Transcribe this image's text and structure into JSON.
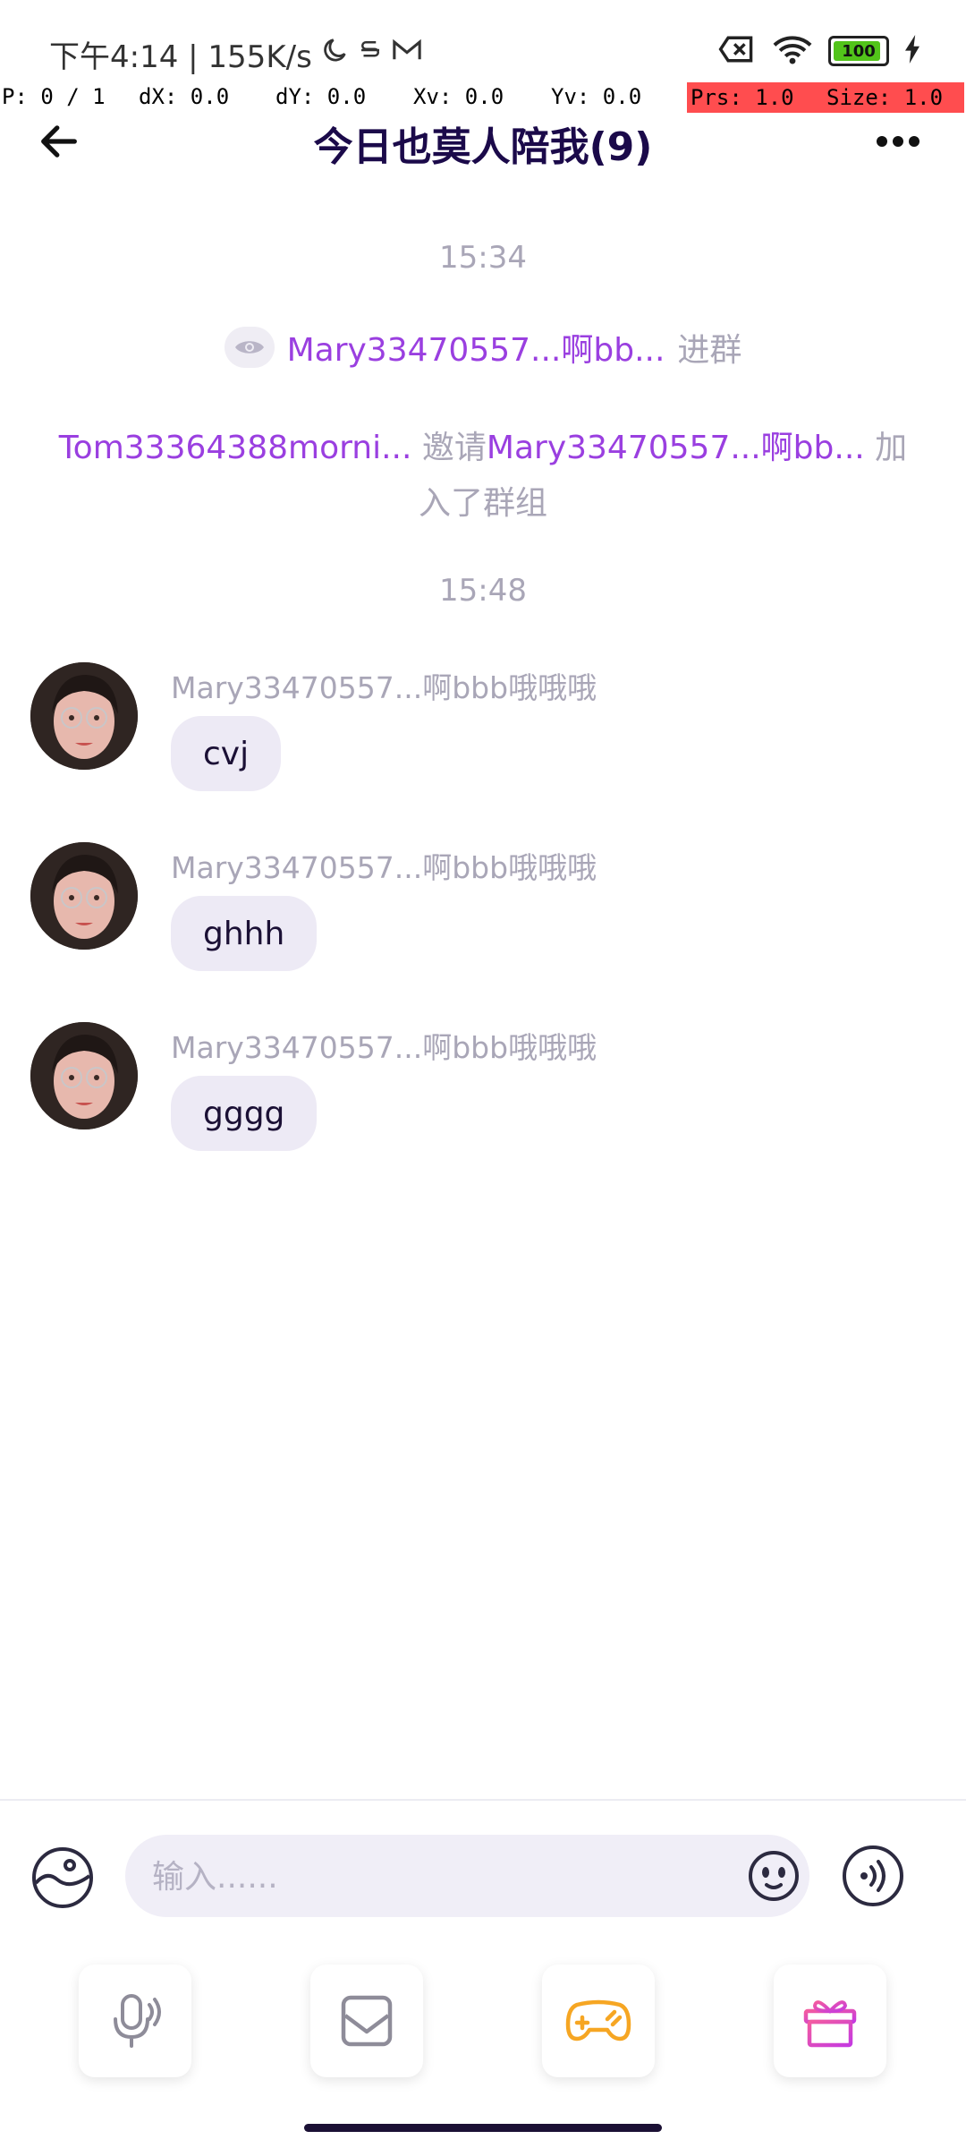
{
  "status_bar": {
    "time_speed": "下午4:14 | 155K/s",
    "battery_level": "100"
  },
  "debug": {
    "p": "P: 0 / 1",
    "dx": "dX: 0.0",
    "dy": "dY: 0.0",
    "xv": "Xv: 0.0",
    "yv": "Yv: 0.0",
    "prs": "Prs: 1.0",
    "size": "Size: 1.0"
  },
  "header": {
    "title": "今日也莫人陪我(9)"
  },
  "chat": {
    "time1": "15:34",
    "join_user": "Mary33470557...啊bb...",
    "join_text": "进群",
    "invite_user1": "Tom33364388morni...",
    "invite_mid": "邀请",
    "invite_user2": "Mary33470557...啊bb...",
    "invite_end": "加入了群组",
    "time2": "15:48",
    "messages": [
      {
        "sender": "Mary33470557...啊bbb哦哦哦",
        "text": "cvj"
      },
      {
        "sender": "Mary33470557...啊bbb哦哦哦",
        "text": "ghhh"
      },
      {
        "sender": "Mary33470557...啊bbb哦哦哦",
        "text": "gggg"
      }
    ]
  },
  "composer": {
    "placeholder": "输入......"
  },
  "icons": {
    "back": "arrow-left-icon",
    "more": "more-dots-icon",
    "eye": "eye-icon",
    "photo": "image-landscape-icon",
    "emoji": "smile-face-icon",
    "voice_mode": "sound-wave-icon",
    "mic": "microphone-icon",
    "album": "photo-frame-icon",
    "game": "gamepad-icon",
    "gift": "gift-icon"
  },
  "colors": {
    "accent_purple": "#9a3fe0",
    "bubble_bg": "#edeaf5",
    "game_orange": "#f6a623",
    "gift_pink": "#ec4fa5"
  }
}
